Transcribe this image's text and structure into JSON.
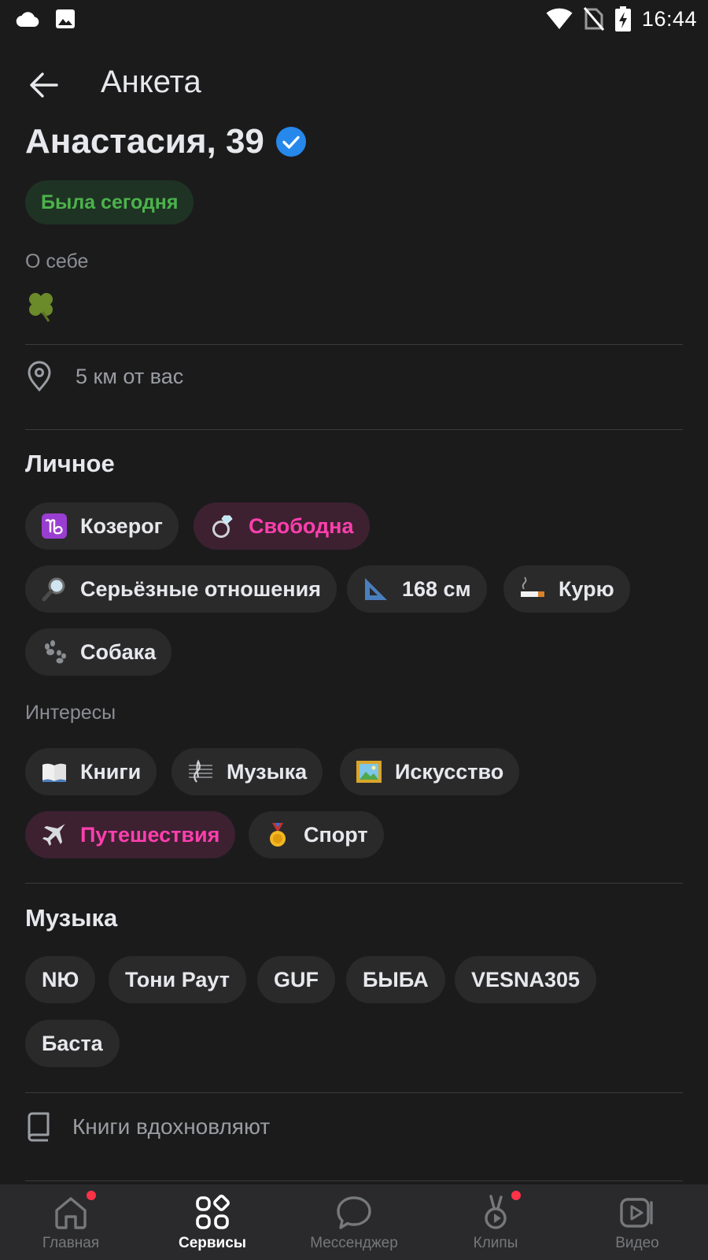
{
  "status_bar": {
    "time": "16:44",
    "left_icons": [
      "cloud-icon",
      "image-icon"
    ],
    "right_icons": [
      "wifi-icon",
      "no-sim-icon",
      "battery-charging-icon"
    ]
  },
  "header": {
    "title": "Анкета",
    "back_icon": "arrow-left-icon"
  },
  "profile": {
    "name_age": "Анастасия, 39",
    "verified_icon": "verified-check-icon",
    "online_status": "Была сегодня",
    "about_label": "О себе",
    "about_emoji": "four-leaf-clover",
    "location": "5 км от вас"
  },
  "personal": {
    "title": "Личное",
    "chips": [
      {
        "icon": "capricorn-icon",
        "label": "Козерог",
        "accent": false
      },
      {
        "icon": "ring-icon",
        "label": "Свободна",
        "accent": true
      },
      {
        "icon": "magnifier-icon",
        "label": "Серьёзные отношения",
        "accent": false
      },
      {
        "icon": "triangle-ruler-icon",
        "label": "168 см",
        "accent": false
      },
      {
        "icon": "cigarette-icon",
        "label": "Курю",
        "accent": false
      },
      {
        "icon": "paw-icon",
        "label": "Собака",
        "accent": false
      }
    ]
  },
  "interests": {
    "label": "Интересы",
    "chips": [
      {
        "icon": "book-icon",
        "label": "Книги",
        "accent": false
      },
      {
        "icon": "music-score-icon",
        "label": "Музыка",
        "accent": false
      },
      {
        "icon": "picture-icon",
        "label": "Искусство",
        "accent": false
      },
      {
        "icon": "airplane-icon",
        "label": "Путешествия",
        "accent": true
      },
      {
        "icon": "medal-icon",
        "label": "Спорт",
        "accent": false
      }
    ]
  },
  "music": {
    "title": "Музыка",
    "artists": [
      "NЮ",
      "Тони Раут",
      "GUF",
      "БЫБА",
      "VESNA305",
      "Баста"
    ]
  },
  "books": {
    "icon": "book-outline-icon",
    "text": "Книги вдохновляют"
  },
  "tab_bar": {
    "tabs": [
      {
        "label": "Главная",
        "icon": "home-icon",
        "active": false,
        "badge": true
      },
      {
        "label": "Сервисы",
        "icon": "services-grid-icon",
        "active": true,
        "badge": false
      },
      {
        "label": "Мессенджер",
        "icon": "chat-bubble-icon",
        "active": false,
        "badge": false
      },
      {
        "label": "Клипы",
        "icon": "clips-icon",
        "active": false,
        "badge": true
      },
      {
        "label": "Видео",
        "icon": "video-play-icon",
        "active": false,
        "badge": false
      }
    ]
  },
  "colors": {
    "background": "#1b1b1c",
    "chip": "#2a2a2b",
    "accent_text": "#ff3fae",
    "accent_chip": "#3d2131",
    "online_green": "#4bb34b",
    "verified_blue": "#2688eb",
    "badge_red": "#ff3347"
  }
}
